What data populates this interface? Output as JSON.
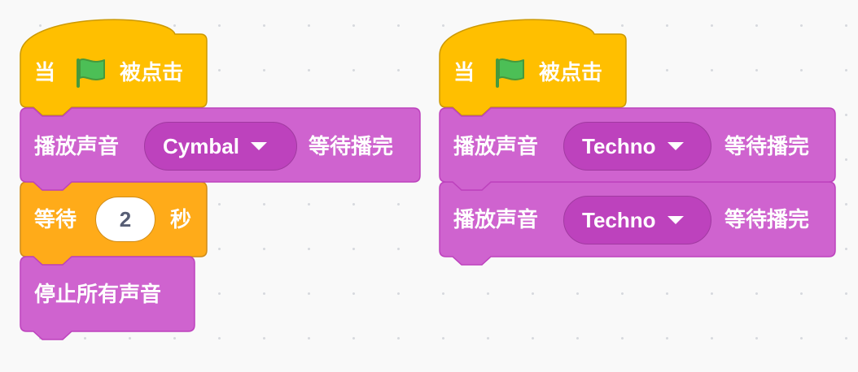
{
  "colors": {
    "events": "#ffbf00",
    "events_border": "#cc9900",
    "sound": "#cf63cf",
    "sound_border": "#bd42bd",
    "control": "#ffab19",
    "control_border": "#cf8b17",
    "flag_green": "#4cbf56"
  },
  "scripts": [
    {
      "hat": {
        "before": "当",
        "icon": "green-flag-icon",
        "after": "被点击"
      },
      "play": {
        "label": "播放声音",
        "sound": "Cymbal",
        "suffix": "等待播完"
      },
      "wait": {
        "label": "等待",
        "value": "2",
        "unit": "秒"
      },
      "stop": {
        "label": "停止所有声音"
      }
    },
    {
      "hat": {
        "before": "当",
        "icon": "green-flag-icon",
        "after": "被点击"
      },
      "play1": {
        "label": "播放声音",
        "sound": "Techno",
        "suffix": "等待播完"
      },
      "play2": {
        "label": "播放声音",
        "sound": "Techno",
        "suffix": "等待播完"
      }
    }
  ]
}
